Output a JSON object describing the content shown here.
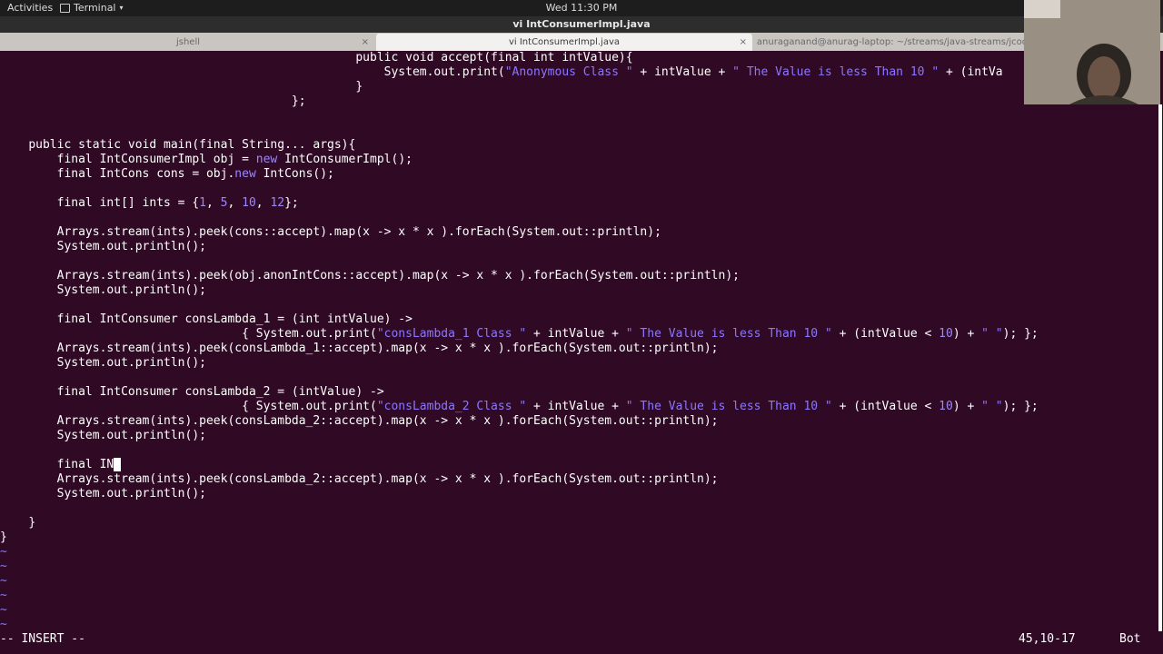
{
  "topbar": {
    "activities": "Activities",
    "app": "Terminal",
    "clock": "Wed 11:30 PM"
  },
  "window": {
    "title": "vi IntConsumerImpl.java"
  },
  "tabs": [
    {
      "label": "jshell"
    },
    {
      "label": "vi IntConsumerImpl.java"
    },
    {
      "label": "anuraganand@anurag-laptop: ~/streams/java-streams/jcod"
    }
  ],
  "editor": {
    "lines": [
      "public void accept(final int intValue){",
      "System.out.print(",
      "\"Anonymous Class \"",
      " + intValue + ",
      "\" The Value is less Than 10 \"",
      " + (intVa",
      "}",
      "};",
      "public static void main(final String... args){",
      "final IntConsumerImpl obj = ",
      "new",
      " IntConsumerImpl();",
      "final IntCons cons = obj.",
      "new",
      " IntCons();",
      "final int[] ints = {",
      "1",
      "5",
      "10",
      "12",
      "};",
      "Arrays.stream(ints).peek(cons::accept).map(x -> x * x ).forEach(System.out::println);",
      "System.out.println();",
      "Arrays.stream(ints).peek(obj.anonIntCons::accept).map(x -> x * x ).forEach(System.out::println);",
      "final IntConsumer consLambda_1 = (int intValue) ->",
      "{ System.out.print(",
      "\"consLambda_1 Class \"",
      "\" The Value is less Than 10 \"",
      " + (intValue < ",
      "10",
      ") + ",
      "\" \"",
      "); };",
      "Arrays.stream(ints).peek(consLambda_1::accept).map(x -> x * x ).forEach(System.out::println);",
      "final IntConsumer consLambda_2 = (intValue) ->",
      "\"consLambda_2 Class \"",
      "Arrays.stream(ints).peek(consLambda_2::accept).map(x -> x * x ).forEach(System.out::println);",
      "final IN",
      "}",
      "}",
      "~"
    ]
  },
  "status": {
    "mode": "-- INSERT --",
    "position": "45,10-17",
    "scroll": "Bot"
  }
}
